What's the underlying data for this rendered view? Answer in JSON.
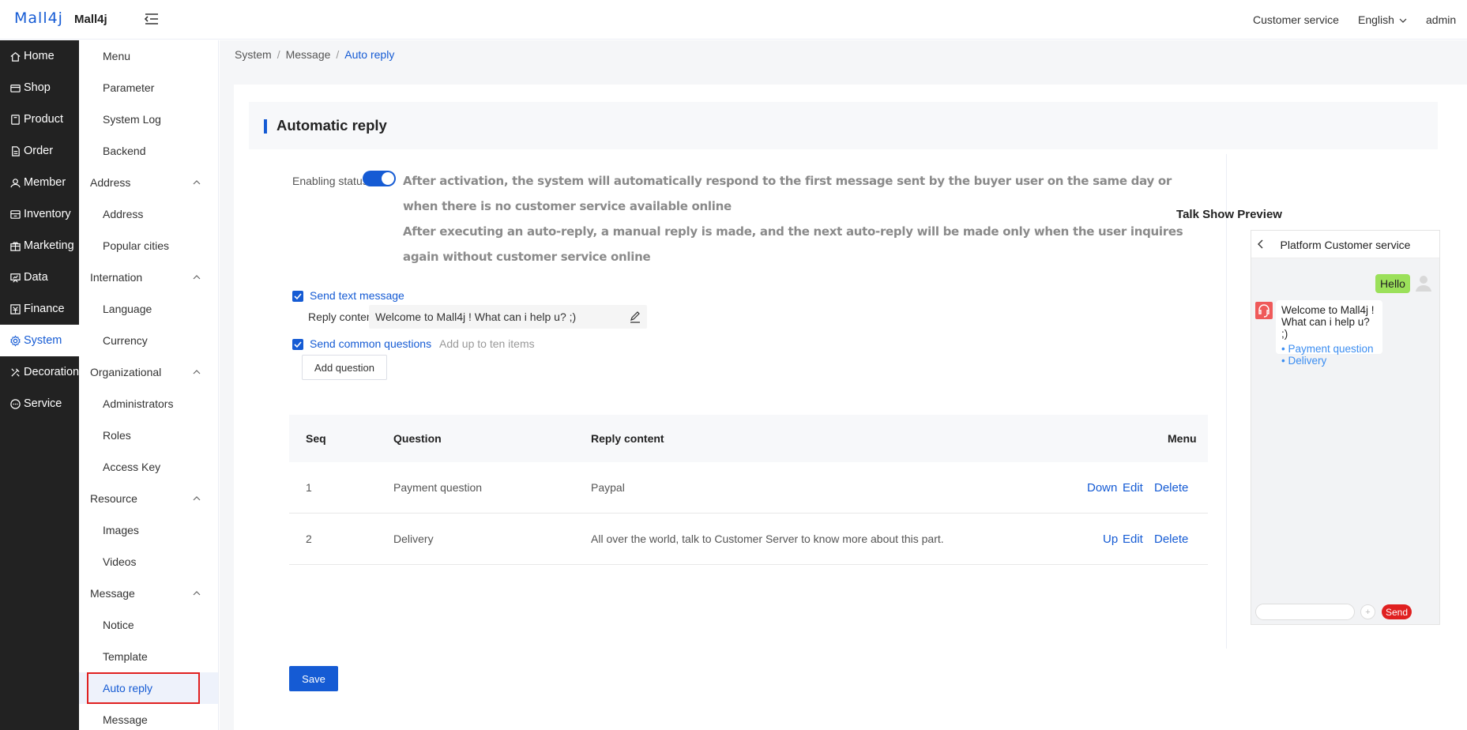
{
  "header": {
    "logo": "Mall4j",
    "brand": "Mall4j",
    "customer_service": "Customer service",
    "language": "English",
    "user": "admin"
  },
  "nav": {
    "items": [
      {
        "label": "Home",
        "icon": "home-icon"
      },
      {
        "label": "Shop",
        "icon": "shop-icon"
      },
      {
        "label": "Product",
        "icon": "product-icon"
      },
      {
        "label": "Order",
        "icon": "order-icon"
      },
      {
        "label": "Member",
        "icon": "member-icon"
      },
      {
        "label": "Inventory",
        "icon": "inventory-icon"
      },
      {
        "label": "Marketing",
        "icon": "marketing-icon"
      },
      {
        "label": "Data",
        "icon": "data-icon"
      },
      {
        "label": "Finance",
        "icon": "finance-icon"
      },
      {
        "label": "System",
        "icon": "system-gear-icon"
      },
      {
        "label": "Decoration",
        "icon": "decoration-icon"
      },
      {
        "label": "Service",
        "icon": "service-chat-icon"
      }
    ]
  },
  "submenu": {
    "menu": "Menu",
    "parameter": "Parameter",
    "system_log": "System Log",
    "backend": "Backend",
    "address_group": "Address",
    "address": "Address",
    "popular_cities": "Popular cities",
    "internation_group": "Internation",
    "language": "Language",
    "currency": "Currency",
    "organizational_group": "Organizational",
    "administrators": "Administrators",
    "roles": "Roles",
    "access_key": "Access Key",
    "resource_group": "Resource",
    "images": "Images",
    "videos": "Videos",
    "message_group": "Message",
    "notice": "Notice",
    "template": "Template",
    "auto_reply": "Auto reply",
    "message": "Message"
  },
  "breadcrumb": [
    "System",
    "Message",
    "Auto reply"
  ],
  "page": {
    "title": "Automatic reply",
    "enabling_label": "Enabling status:",
    "enabled": true,
    "desc_line1": "After activation, the system will automatically respond to the first message sent by the buyer user on the same day or when there is no customer service available online",
    "desc_line2": "After executing an auto-reply, a manual reply is made, and the next auto-reply will be made only when the user inquires again without customer service online",
    "send_text_label": "Send text message",
    "send_text_checked": true,
    "reply_label": "Reply content:",
    "reply_value": "Welcome to Mall4j ! What can i help u? ;)",
    "send_questions_label": "Send common questions",
    "send_questions_checked": true,
    "send_questions_hint": "Add up to ten items",
    "add_question": "Add question",
    "save": "Save"
  },
  "table": {
    "columns": [
      "Seq",
      "Question",
      "Reply content",
      "Menu"
    ],
    "rows": [
      {
        "seq": "1",
        "question": "Payment question",
        "reply": "Paypal",
        "actions": [
          "Down",
          "Edit",
          "Delete"
        ]
      },
      {
        "seq": "2",
        "question": "Delivery",
        "reply": "All over the world, talk to Customer Server to know more about this part.",
        "actions": [
          "Up",
          "Edit",
          "Delete"
        ]
      }
    ]
  },
  "preview": {
    "title": "Talk Show Preview",
    "header": "Platform Customer service",
    "user_msg": "Hello",
    "bot_welcome": "Welcome to Mall4j ! What can i help u? ;)",
    "bot_q1": "• Payment question",
    "bot_q2": "• Delivery",
    "plus": "+",
    "send": "Send"
  },
  "colors": {
    "accent": "#155bd4",
    "sidebar_bg": "#222222",
    "send_red": "#e02020",
    "hello_green": "#9be05a"
  }
}
